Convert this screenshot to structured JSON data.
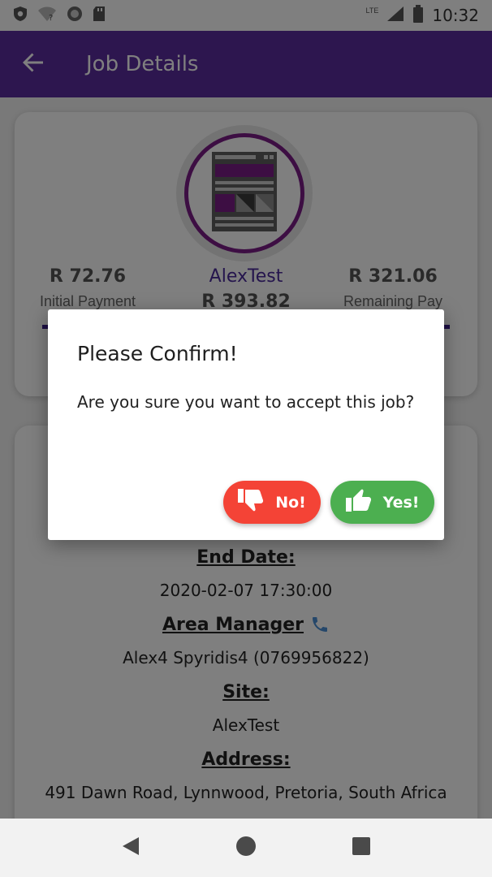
{
  "status_bar": {
    "time": "10:32",
    "network": "LTE",
    "icons": [
      "shield-icon",
      "wifi-question-icon",
      "circle-icon",
      "sd-card-icon",
      "signal-icon",
      "battery-icon"
    ]
  },
  "app_bar": {
    "title": "Job Details",
    "back_icon": "arrow-left-icon",
    "color": "#5b2d9e"
  },
  "job_card": {
    "avatar_icon": "newspaper-icon",
    "initial_payment_value": "R 72.76",
    "initial_payment_label": "Initial Payment",
    "name": "AlexTest",
    "total": "R 393.82",
    "remaining_pay_value": "R 321.06",
    "remaining_pay_label": "Remaining Pay"
  },
  "details": {
    "end_date_label": "End Date:",
    "end_date_value": "2020-02-07 17:30:00",
    "area_manager_label": "Area Manager",
    "area_manager_value": "Alex4 Spyridis4 (0769956822)",
    "site_label": "Site:",
    "site_value": "AlexTest",
    "address_label": "Address:",
    "address_value": "491 Dawn Road, Lynnwood, Pretoria, South Africa"
  },
  "dialog": {
    "title": "Please Confirm!",
    "message": "Are you sure you want to accept this job?",
    "no_label": "No!",
    "yes_label": "Yes!",
    "no_color": "#f44336",
    "yes_color": "#4caf50"
  },
  "nav_bar": {
    "icons": [
      "back-triangle-icon",
      "home-circle-icon",
      "recents-square-icon"
    ]
  }
}
